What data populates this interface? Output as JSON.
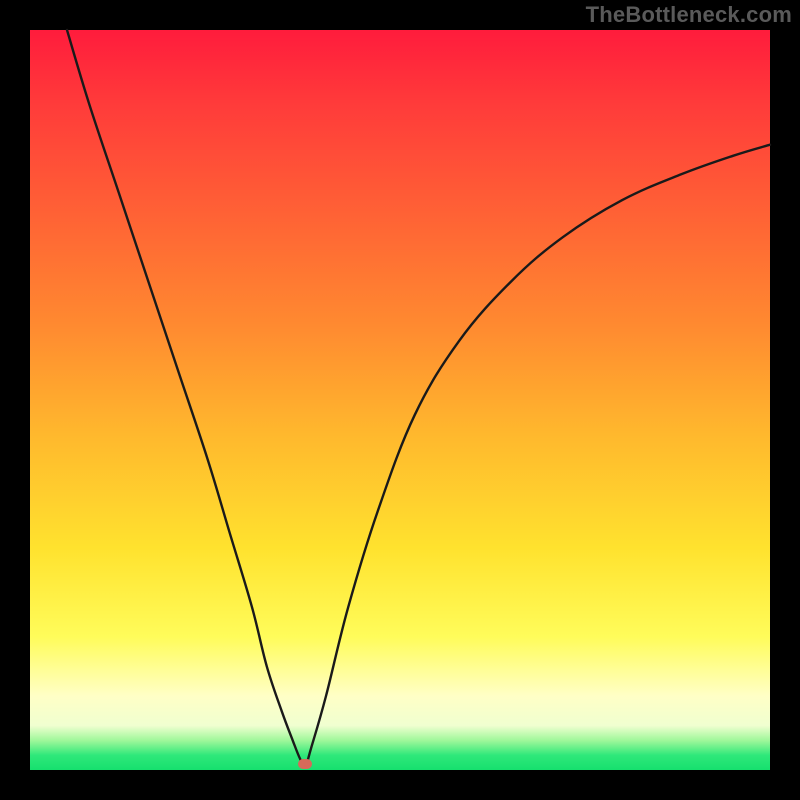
{
  "watermark": "TheBottleneck.com",
  "colors": {
    "frame_bg": "#000000",
    "watermark_text": "#5a5a5a",
    "curve_stroke": "#1a1a1a",
    "marker_fill": "#d66a5a",
    "gradient_stops": [
      {
        "pos": 0.0,
        "hex": "#ff1c3c"
      },
      {
        "pos": 0.1,
        "hex": "#ff3b3a"
      },
      {
        "pos": 0.25,
        "hex": "#ff6235"
      },
      {
        "pos": 0.4,
        "hex": "#ff8a30"
      },
      {
        "pos": 0.55,
        "hex": "#ffb92d"
      },
      {
        "pos": 0.7,
        "hex": "#ffe22e"
      },
      {
        "pos": 0.82,
        "hex": "#fffc5a"
      },
      {
        "pos": 0.9,
        "hex": "#ffffc6"
      },
      {
        "pos": 0.94,
        "hex": "#f0ffd0"
      },
      {
        "pos": 0.96,
        "hex": "#9ff79a"
      },
      {
        "pos": 0.98,
        "hex": "#2fe87a"
      },
      {
        "pos": 1.0,
        "hex": "#16e06e"
      }
    ]
  },
  "chart_data": {
    "type": "line",
    "title": "",
    "xlabel": "",
    "ylabel": "",
    "xlim": [
      0,
      100
    ],
    "ylim": [
      0,
      100
    ],
    "series": [
      {
        "name": "left-branch",
        "x": [
          5,
          8,
          12,
          16,
          20,
          24,
          27,
          30,
          32,
          34,
          35.5,
          36.5,
          37.2
        ],
        "y": [
          100,
          90,
          78,
          66,
          54,
          42,
          32,
          22,
          14,
          8,
          4,
          1.5,
          0.5
        ]
      },
      {
        "name": "right-branch",
        "x": [
          37.2,
          38,
          40,
          43,
          47,
          52,
          58,
          65,
          72,
          80,
          88,
          95,
          100
        ],
        "y": [
          0.5,
          3,
          10,
          22,
          35,
          48,
          58,
          66,
          72,
          77,
          80.5,
          83,
          84.5
        ]
      }
    ],
    "marker": {
      "x": 37.2,
      "y": 0.8
    },
    "notes": "V-shaped bottleneck curve on vertical red→green gradient. Minimum (optimal point) near x≈37. Left branch is near-linear steep descent from top-left; right branch rises with diminishing slope toward ~85% at right edge. Axes unlabeled; values are percent estimates read from gridless plot."
  }
}
